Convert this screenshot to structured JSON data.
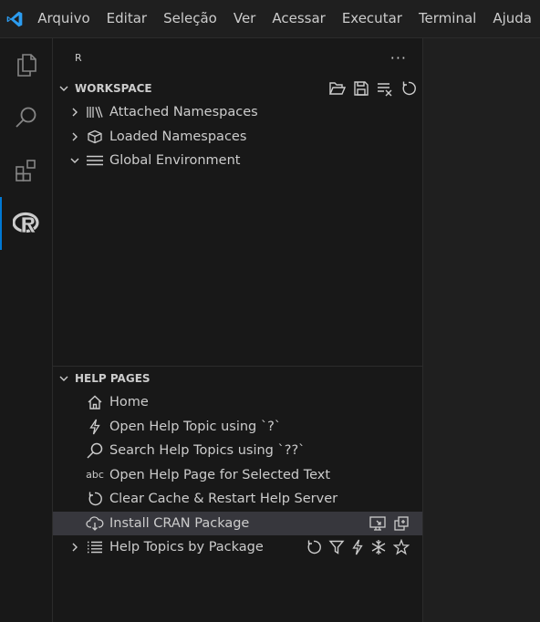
{
  "menubar": {
    "logo_icon": "vscode-logo-icon",
    "items": [
      "Arquivo",
      "Editar",
      "Seleção",
      "Ver",
      "Acessar",
      "Executar",
      "Terminal",
      "Ajuda"
    ]
  },
  "activitybar": {
    "items": [
      "explorer-icon",
      "search-icon",
      "extensions-icon",
      "r-icon"
    ],
    "active_index": 3
  },
  "sidebar": {
    "title": "R",
    "more_label": "···",
    "workspace": {
      "header": "WORKSPACE",
      "actions": [
        "open-folder-icon",
        "save-icon",
        "clear-all-icon",
        "refresh-icon"
      ],
      "items": [
        {
          "label": "Attached Namespaces",
          "icon": "library-icon",
          "expanded": false
        },
        {
          "label": "Loaded Namespaces",
          "icon": "package-icon",
          "expanded": false
        },
        {
          "label": "Global Environment",
          "icon": "list-icon",
          "expanded": true
        }
      ]
    },
    "help": {
      "header": "HELP PAGES",
      "items": [
        {
          "label": "Home",
          "icon": "home-icon"
        },
        {
          "label": "Open Help Topic using `?`",
          "icon": "zap-icon"
        },
        {
          "label": "Search Help Topics using `??`",
          "icon": "search-icon"
        },
        {
          "label": "Open Help Page for Selected Text",
          "icon": "abc-icon",
          "icon_text": "abc"
        },
        {
          "label": "Clear Cache & Restart Help Server",
          "icon": "refresh-icon"
        },
        {
          "label": "Install CRAN Package",
          "icon": "cloud-download-icon",
          "selected": true,
          "actions": [
            "open-preview-icon",
            "multiple-windows-icon"
          ]
        },
        {
          "label": "Help Topics by Package",
          "icon": "list-flat-icon",
          "expanded": false,
          "actions": [
            "refresh-icon",
            "filter-icon",
            "zap-icon",
            "snowflake-icon",
            "star-icon"
          ]
        }
      ]
    }
  },
  "colors": {
    "accent": "#0078d4",
    "selection_bg": "#37373d",
    "sidebar_bg": "#181818",
    "editor_bg": "#1f1f1f"
  }
}
